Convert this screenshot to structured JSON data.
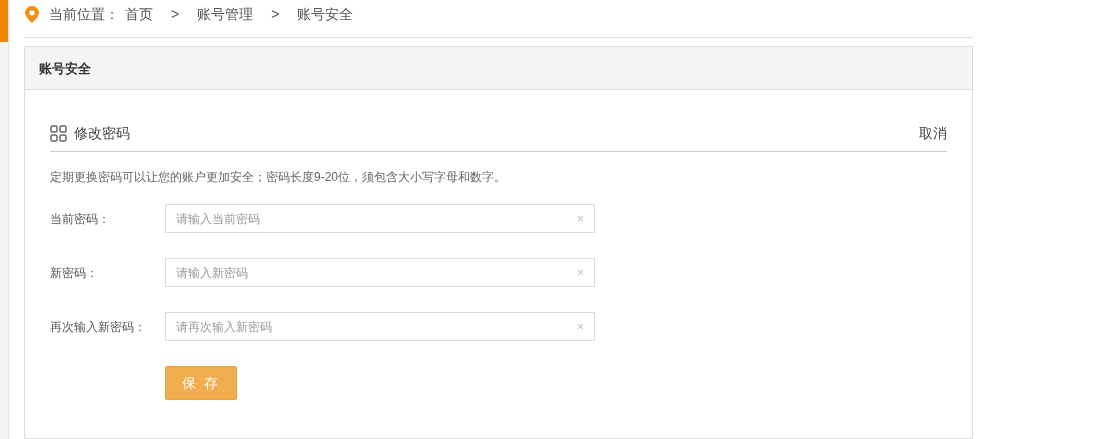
{
  "breadcrumb": {
    "label": "当前位置：",
    "items": [
      "首页",
      "账号管理",
      "账号安全"
    ],
    "separator": ">"
  },
  "panel": {
    "title": "账号安全",
    "section": {
      "title": "修改密码",
      "cancel": "取消",
      "description": "定期更换密码可以让您的账户更加安全；密码长度9-20位，须包含大小写字母和数字。",
      "fields": [
        {
          "label": "当前密码：",
          "placeholder": "请输入当前密码",
          "clear": "×"
        },
        {
          "label": "新密码：",
          "placeholder": "请输入新密码",
          "clear": "×"
        },
        {
          "label": "再次输入新密码：",
          "placeholder": "请再次输入新密码",
          "clear": "×"
        }
      ],
      "save": "保 存"
    }
  }
}
